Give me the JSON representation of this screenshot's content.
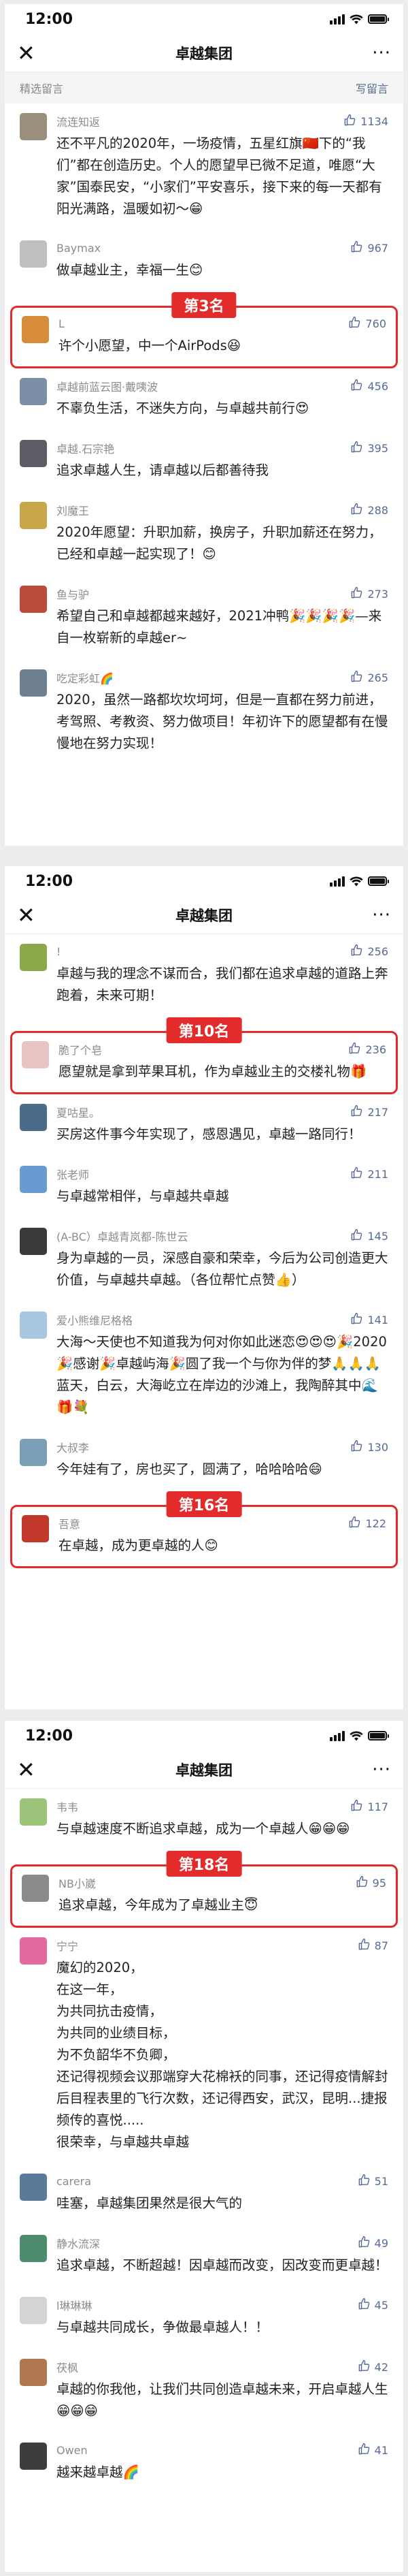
{
  "status_time": "12:00",
  "nav_title": "卓越集团",
  "close_glyph": "✕",
  "more_glyph": "···",
  "section_title": "精选留言",
  "write_link": "写留言",
  "panel1": [
    {
      "name": "流连知返",
      "likes": "1134",
      "avatar": "#9a8f7c",
      "text": "还不平凡的2020年，一场疫情，五星红旗🇨🇳下的“我们”都在创造历史。个人的愿望早已微不足道，唯愿“大家”国泰民安，“小家们”平安喜乐，接下来的每一天都有阳光满路，温暖如初～😁"
    },
    {
      "name": "Baymax",
      "likes": "967",
      "avatar": "#bfbfbf",
      "text": "做卓越业主，幸福一生😊"
    },
    {
      "name": "L",
      "likes": "760",
      "avatar": "#d78c3c",
      "text": "许个小愿望，中一个AirPods😆",
      "rank": "第3名"
    },
    {
      "name": "卓越前蓝云图·戴咦波",
      "likes": "456",
      "avatar": "#7a8fa6",
      "text": "不辜负生活，不迷失方向，与卓越共前行😍"
    },
    {
      "name": "卓越.石宗艳",
      "likes": "395",
      "avatar": "#5c5c64",
      "text": "追求卓越人生，请卓越以后都善待我"
    },
    {
      "name": "刘魔王",
      "likes": "288",
      "avatar": "#c9a64a",
      "text": "2020年愿望：升职加薪，换房子，升职加薪还在努力，已经和卓越一起实现了！😊"
    },
    {
      "name": "鱼与驴",
      "likes": "273",
      "avatar": "#b84b3c",
      "text": "希望自己和卓越都越来越好，2021冲鸭🎉🎉🎉🎉—来自一枚崭新的卓越er~"
    },
    {
      "name": "吃定彩虹🌈",
      "likes": "265",
      "avatar": "#6e7f8f",
      "text": "2020，虽然一路都坎坎坷坷，但是一直都在努力前进，考驾照、考教资、努力做项目！年初许下的愿望都有在慢慢地在努力实现！"
    }
  ],
  "panel2": [
    {
      "name": "!",
      "likes": "256",
      "avatar": "#8ba84a",
      "text": "卓越与我的理念不谋而合，我们都在追求卓越的道路上奔跑着，未来可期！"
    },
    {
      "name": "脆了个皂",
      "likes": "236",
      "avatar": "#e8c4c4",
      "text": "愿望就是拿到苹果耳机，作为卓越业主的交楼礼物🎁",
      "rank": "第10名"
    },
    {
      "name": "夏咕星。",
      "likes": "217",
      "avatar": "#4a6b8a",
      "text": "买房这件事今年实现了，感恩遇见，卓越一路同行！"
    },
    {
      "name": "张老师",
      "likes": "211",
      "avatar": "#6a9bd0",
      "text": "与卓越常相伴，与卓越共卓越"
    },
    {
      "name": "(A-BC）卓越青岚都-陈世云",
      "likes": "145",
      "avatar": "#3a3a3a",
      "text": "身为卓越的一员，深感自豪和荣幸，今后为公司创造更大价值，与卓越共卓越。（各位帮忙点赞👍）"
    },
    {
      "name": "爱小熊维尼格格",
      "likes": "141",
      "avatar": "#a8c6e0",
      "text": "大海～天使也不知道我为何对你如此迷恋😍😍😍🎉2020🎉感谢🎉卓越屿海🎉圆了我一个与你为伴的梦🙏🙏🙏 蓝天，白云，大海屹立在岸边的沙滩上，我陶醉其中🌊🎁💐"
    },
    {
      "name": "大叔李",
      "likes": "130",
      "avatar": "#7c9fb8",
      "text": "今年娃有了，房也买了，圆满了，哈哈哈哈😄"
    },
    {
      "name": "吾意",
      "likes": "122",
      "avatar": "#c0392b",
      "text": "在卓越，成为更卓越的人😊",
      "rank": "第16名"
    }
  ],
  "panel3": [
    {
      "name": "韦韦",
      "likes": "117",
      "avatar": "#9bc47a",
      "text": "与卓越速度不断追求卓越，成为一个卓越人😁😁😁"
    },
    {
      "name": "NB小崴",
      "likes": "95",
      "avatar": "#8a8a8a",
      "text": "追求卓越，今年成为了卓越业主😇",
      "rank": "第18名"
    },
    {
      "name": "宁宁",
      "likes": "87",
      "avatar": "#e26aa0",
      "text": "魔幻的2020，\n在这一年，\n为共同抗击疫情，\n为共同的业绩目标，\n为不负韶华不负卿，\n还记得视频会议那端穿大花棉袄的同事，还记得疫情解封后目程表里的飞行次数，还记得西安，武汉，昆明...捷报频传的喜悦.....\n很荣幸，与卓越共卓越"
    },
    {
      "name": "carera",
      "likes": "51",
      "avatar": "#5a7a9a",
      "text": "哇塞，卓越集团果然是很大气的"
    },
    {
      "name": "静水流深",
      "likes": "49",
      "avatar": "#4e8c6e",
      "text": "追求卓越，不断超越！因卓越而改变，因改变而更卓越！"
    },
    {
      "name": "l琳琳琳",
      "likes": "45",
      "avatar": "#d4d4d4",
      "text": "与卓越共同成长，争做最卓越人！！"
    },
    {
      "name": "茯枫",
      "likes": "42",
      "avatar": "#b07850",
      "text": "卓越的你我他，让我们共同创造卓越未来，开启卓越人生😁😁😁"
    },
    {
      "name": "Owen",
      "likes": "41",
      "avatar": "#3d3d3d",
      "text": "越来越卓越🌈"
    }
  ],
  "colors": {
    "rank_red": "#e32b2b",
    "link_blue": "#576b95"
  },
  "icons": [
    "close-icon",
    "more-icon",
    "thumb-up-icon",
    "signal-icon",
    "wifi-icon",
    "battery-icon"
  ]
}
